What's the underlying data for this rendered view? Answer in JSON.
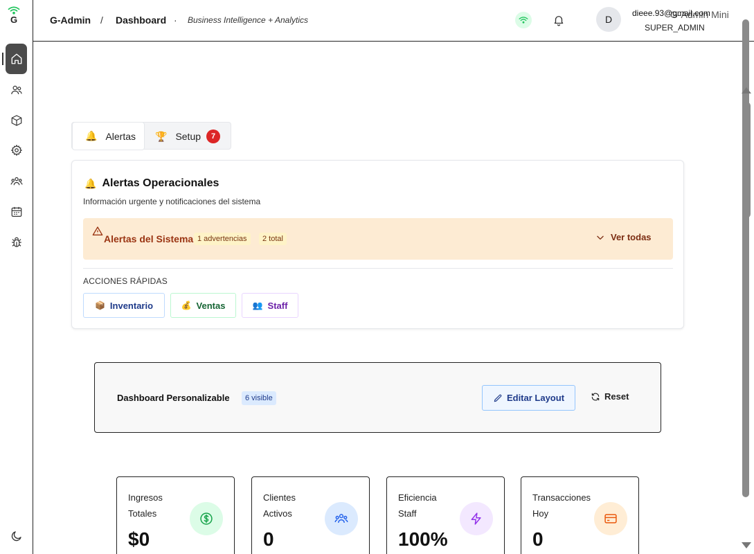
{
  "app": {
    "logo_letter": "G"
  },
  "header": {
    "brand": "G-Admin",
    "separator1": "/",
    "page": "Dashboard",
    "separator2": "·",
    "subtitle": "Business Intelligence + Analytics",
    "avatar_initial": "D",
    "user_email": "dieee.93@gmail.com",
    "user_name": "G-Admin Mini",
    "user_role": "SUPER_ADMIN"
  },
  "sidebar": {
    "items": [
      {
        "name": "home",
        "icon": "home-icon",
        "active": true
      },
      {
        "name": "users",
        "icon": "users-icon"
      },
      {
        "name": "box",
        "icon": "cube-icon"
      },
      {
        "name": "settings",
        "icon": "gear-icon"
      },
      {
        "name": "team",
        "icon": "group-icon"
      },
      {
        "name": "calendar",
        "icon": "calendar-icon"
      },
      {
        "name": "debug",
        "icon": "bug-icon"
      }
    ],
    "theme_icon": "moon-icon"
  },
  "tabs": [
    {
      "emoji": "🔔",
      "label": "Alertas",
      "active": true
    },
    {
      "emoji": "🏆",
      "label": "Setup",
      "badge": "7"
    }
  ],
  "alerts_card": {
    "emoji": "🔔",
    "title": "Alertas Operacionales",
    "description": "Información urgente y notificaciones del sistema",
    "alert": {
      "title": "Alertas del Sistema",
      "pill_warnings": "1 advertencias",
      "pill_total": "2 total",
      "action": "Ver todas"
    },
    "quick_actions_label": "ACCIONES RÁPIDAS",
    "quick_actions": [
      {
        "emoji": "📦",
        "label": "Inventario"
      },
      {
        "emoji": "💰",
        "label": "Ventas"
      },
      {
        "emoji": "👥",
        "label": "Staff"
      }
    ]
  },
  "dashboard_custom": {
    "title": "Dashboard Personalizable",
    "badge": "6 visible",
    "edit_label": "Editar Layout",
    "reset_label": "Reset"
  },
  "stats": [
    {
      "label": "Ingresos Totales",
      "value": "$0",
      "icon": "dollar-icon",
      "color": "#dcfce7",
      "icon_color": "#16a34a"
    },
    {
      "label": "Clientes Activos",
      "value": "0",
      "icon": "group-icon",
      "color": "#dbeafe",
      "icon_color": "#2563eb"
    },
    {
      "label": "Eficiencia Staff",
      "value": "100%",
      "icon": "bolt-icon",
      "color": "#f3e8ff",
      "icon_color": "#9333ea"
    },
    {
      "label": "Transacciones Hoy",
      "value": "0",
      "icon": "credit-card-icon",
      "color": "#ffedd5",
      "icon_color": "#ea580c"
    }
  ]
}
